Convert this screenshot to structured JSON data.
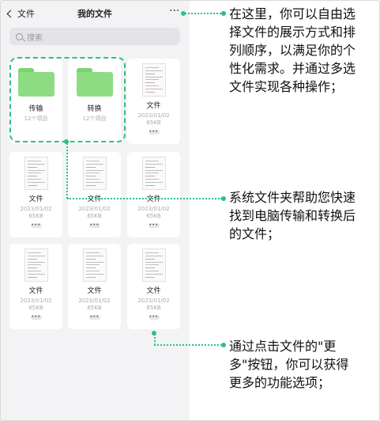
{
  "nav": {
    "back_label": "文件",
    "title": "我的文件",
    "more_label": "···"
  },
  "search": {
    "placeholder": "搜索"
  },
  "folders": [
    {
      "name": "传输",
      "count": "12个项目"
    },
    {
      "name": "转换",
      "count": "12个项目"
    }
  ],
  "files": [
    {
      "name": "文件",
      "date": "2023/01/02",
      "size": "65KB"
    },
    {
      "name": "文件",
      "date": "2023/01/02",
      "size": "65KB"
    },
    {
      "name": "文件",
      "date": "2023/01/02",
      "size": "65KB"
    },
    {
      "name": "文件",
      "date": "2023/01/02",
      "size": "65KB"
    },
    {
      "name": "文件",
      "date": "2023/01/02",
      "size": "65KB"
    },
    {
      "name": "文件",
      "date": "2023/01/02",
      "size": "65KB"
    },
    {
      "name": "文件",
      "date": "2023/01/02",
      "size": "65KB"
    }
  ],
  "more_dots": "•••",
  "annotations": {
    "top": [
      "在这里，你可以自由选",
      "择文件的展示方式和排",
      "列顺序，以满足你的个",
      "性化需求。并通过多选",
      "文件实现各种操作；"
    ],
    "middle": [
      "系统文件夹帮助您快速",
      "找到电脑传输和转换后",
      "的文件；"
    ],
    "bottom": [
      "通过点击文件的\"更",
      "多\"按钮，你可以获得",
      "更多的功能选项；"
    ]
  },
  "colors": {
    "accent": "#2ec27e",
    "folder": "#8ddc84",
    "screen_bg": "#f3f3f5"
  }
}
